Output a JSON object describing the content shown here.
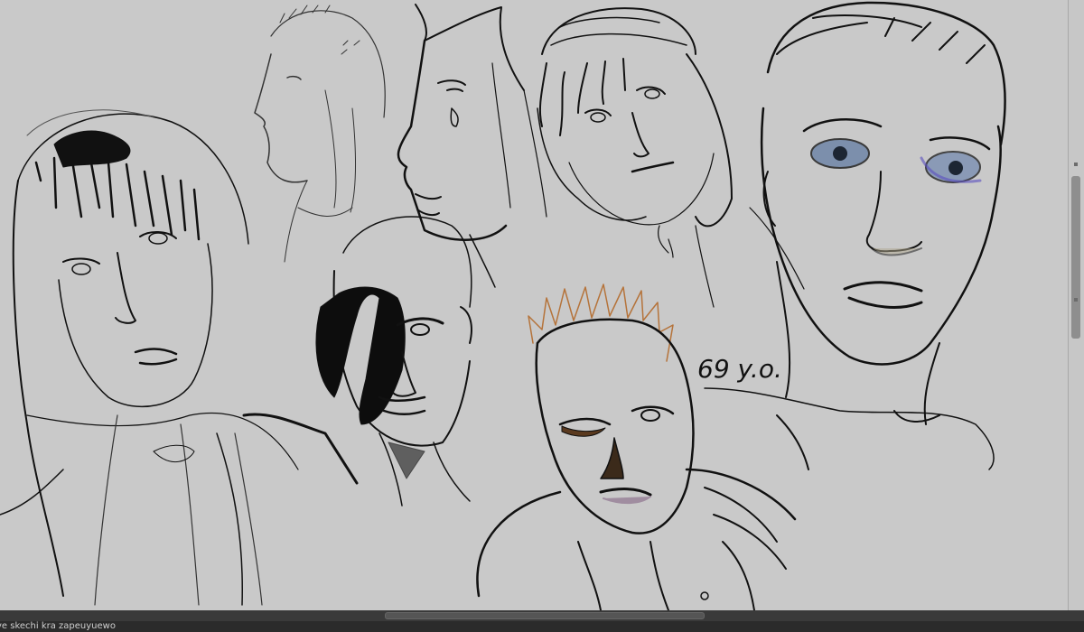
{
  "canvas": {
    "background": "#c9c9c9",
    "handwritten_note": "69 y.o."
  },
  "status": {
    "document_name": "ve skechi kra zapeuyuewo"
  },
  "colors": {
    "ink": "#111111",
    "eye_blue": "#6f86a8",
    "hair_orange": "#b5733a",
    "skin_brown": "#5b3a1f",
    "lips_purple": "#8f7590"
  }
}
